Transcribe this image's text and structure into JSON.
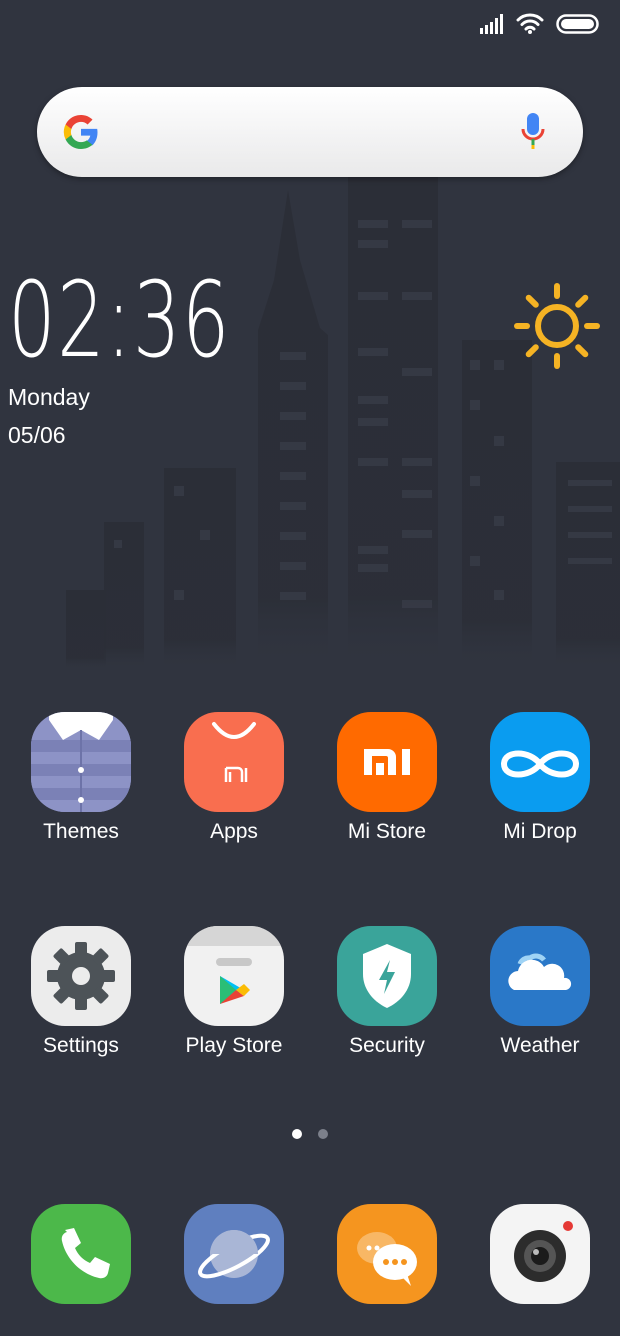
{
  "status": {
    "signal": "signal-icon",
    "wifi": "wifi-icon",
    "battery": "battery-icon"
  },
  "search": {
    "logo": "google-g-icon",
    "mic": "mic-icon"
  },
  "clock": {
    "time": "02:36",
    "day": "Monday",
    "date": "05/06",
    "weather_icon": "sun-icon"
  },
  "apps": [
    {
      "label": "Themes",
      "icon": "themes-icon"
    },
    {
      "label": "Apps",
      "icon": "apps-icon"
    },
    {
      "label": "Mi Store",
      "icon": "mi-store-icon"
    },
    {
      "label": "Mi Drop",
      "icon": "mi-drop-icon"
    },
    {
      "label": "Settings",
      "icon": "settings-icon"
    },
    {
      "label": "Play Store",
      "icon": "play-store-icon"
    },
    {
      "label": "Security",
      "icon": "security-icon"
    },
    {
      "label": "Weather",
      "icon": "weather-icon"
    }
  ],
  "pager": {
    "count": 2,
    "active": 1
  },
  "dock": [
    {
      "icon": "phone-icon"
    },
    {
      "icon": "browser-icon"
    },
    {
      "icon": "messages-icon"
    },
    {
      "icon": "camera-icon"
    }
  ],
  "colors": {
    "background": "#30343f",
    "sun": "#f5b324",
    "mi_orange": "#ff6a00",
    "apps_coral": "#f96e4f",
    "midrop_blue": "#0a9cf0",
    "security_teal": "#3aa49a",
    "weather_blue": "#2a78c8",
    "phone_green": "#4cb84a",
    "browser_blue": "#5f7fbf",
    "messages_orange": "#f5951f"
  }
}
